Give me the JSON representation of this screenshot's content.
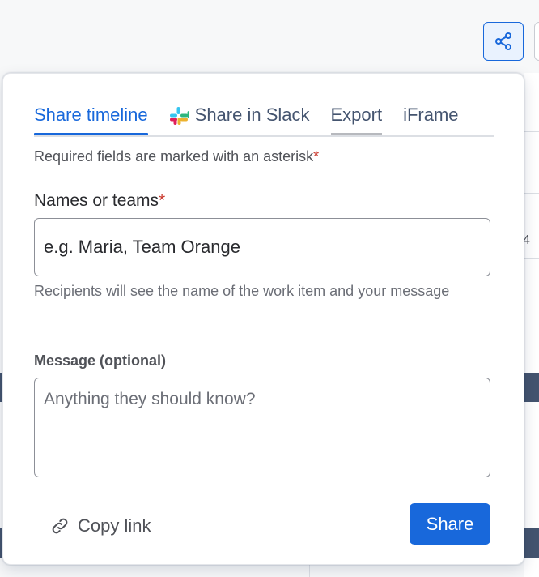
{
  "tabs": [
    {
      "label": "Share timeline",
      "state": "active"
    },
    {
      "label": "Share in Slack",
      "icon": "slack-icon"
    },
    {
      "label": "Export",
      "state": "hover"
    },
    {
      "label": "iFrame"
    }
  ],
  "form": {
    "required_note": "Required fields are marked with an asterisk",
    "asterisk": "*",
    "names_label": "Names or teams",
    "names_placeholder": "e.g. Maria, Team Orange",
    "names_help": "Recipients will see the name of the work item and your message",
    "message_label": "Message (optional)",
    "message_placeholder": "Anything they should know?"
  },
  "footer": {
    "copy_link_label": "Copy link",
    "share_label": "Share"
  },
  "background_page": {
    "edge_text": "4"
  },
  "colors": {
    "accent": "#1868db",
    "required": "#c9372c",
    "text": "#292a2e",
    "subtle_text": "#6b6e76"
  }
}
